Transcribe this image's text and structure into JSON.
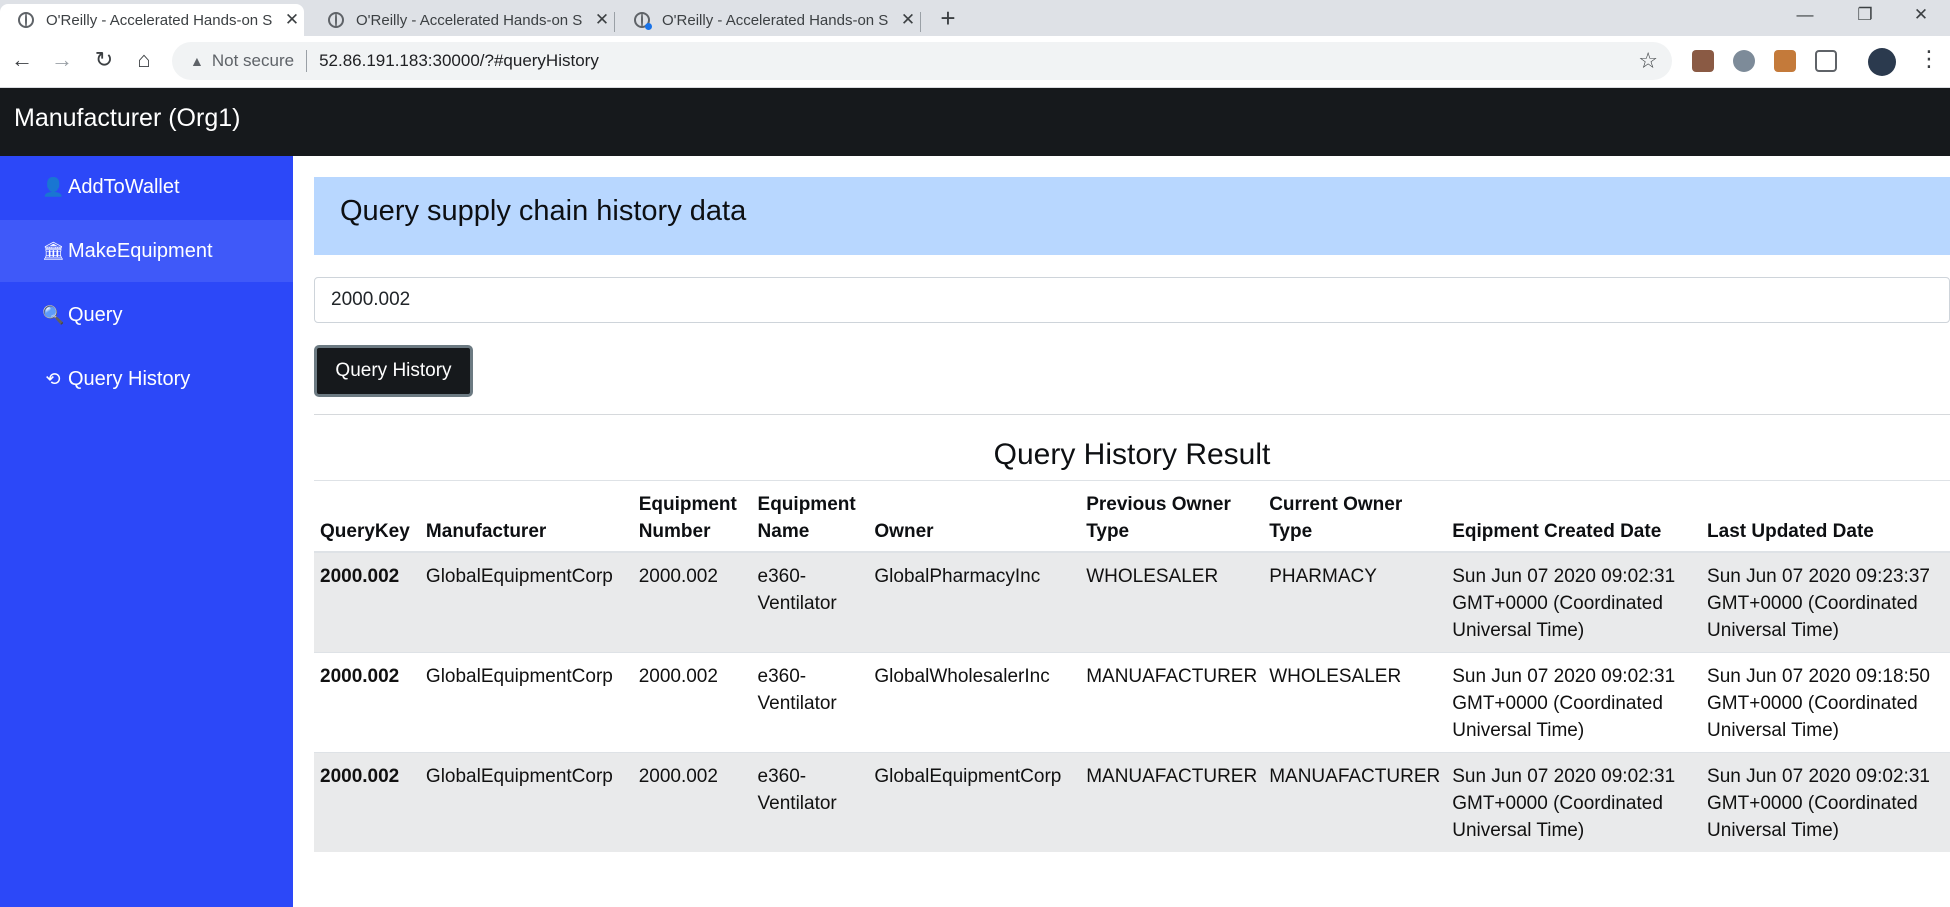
{
  "browser": {
    "tabs": [
      {
        "title": "O'Reilly - Accelerated Hands-on S",
        "active": true
      },
      {
        "title": "O'Reilly - Accelerated Hands-on S",
        "active": false
      },
      {
        "title": "O'Reilly - Accelerated Hands-on S",
        "active": false
      }
    ],
    "new_tab": "+",
    "window_controls": {
      "minimize": "—",
      "restore": "❐",
      "close": "✕"
    },
    "security_label": "Not secure",
    "url": "52.86.191.183:30000/?#queryHistory"
  },
  "app": {
    "brand": "Manufacturer (Org1)"
  },
  "sidebar": {
    "items": [
      {
        "label": "AddToWallet",
        "icon": "user-icon",
        "glyph": "👤"
      },
      {
        "label": "MakeEquipment",
        "icon": "bank-icon",
        "glyph": "🏛"
      },
      {
        "label": "Query",
        "icon": "search-icon",
        "glyph": "🔍"
      },
      {
        "label": "Query History",
        "icon": "history-icon",
        "glyph": "⟲"
      }
    ],
    "active_index": 1
  },
  "main": {
    "heading": "Query supply chain history data",
    "query_input_value": "2000.002",
    "query_button_label": "Query History",
    "result_title": "Query History Result",
    "table": {
      "headers": [
        "QueryKey",
        "Manufacturer",
        "Equipment Number",
        "Equipment Name",
        "Owner",
        "Previous Owner Type",
        "Current Owner Type",
        "Eqipment Created Date",
        "Last Updated Date"
      ],
      "rows": [
        [
          "2000.002",
          "GlobalEquipmentCorp",
          "2000.002",
          "e360-Ventilator",
          "GlobalPharmacyInc",
          "WHOLESALER",
          "PHARMACY",
          "Sun Jun 07 2020 09:02:31 GMT+0000 (Coordinated Universal Time)",
          "Sun Jun 07 2020 09:23:37 GMT+0000 (Coordinated Universal Time)"
        ],
        [
          "2000.002",
          "GlobalEquipmentCorp",
          "2000.002",
          "e360-Ventilator",
          "GlobalWholesalerInc",
          "MANUAFACTURER",
          "WHOLESALER",
          "Sun Jun 07 2020 09:02:31 GMT+0000 (Coordinated Universal Time)",
          "Sun Jun 07 2020 09:18:50 GMT+0000 (Coordinated Universal Time)"
        ],
        [
          "2000.002",
          "GlobalEquipmentCorp",
          "2000.002",
          "e360-Ventilator",
          "GlobalEquipmentCorp",
          "MANUAFACTURER",
          "MANUAFACTURER",
          "Sun Jun 07 2020 09:02:31 GMT+0000 (Coordinated Universal Time)",
          "Sun Jun 07 2020 09:02:31 GMT+0000 (Coordinated Universal Time)"
        ]
      ]
    }
  },
  "colors": {
    "navbar": "#16191c",
    "sidebar": "#2c48f8",
    "jumbotron": "#b8d7ff",
    "striped_row": "#e9eaeb"
  }
}
